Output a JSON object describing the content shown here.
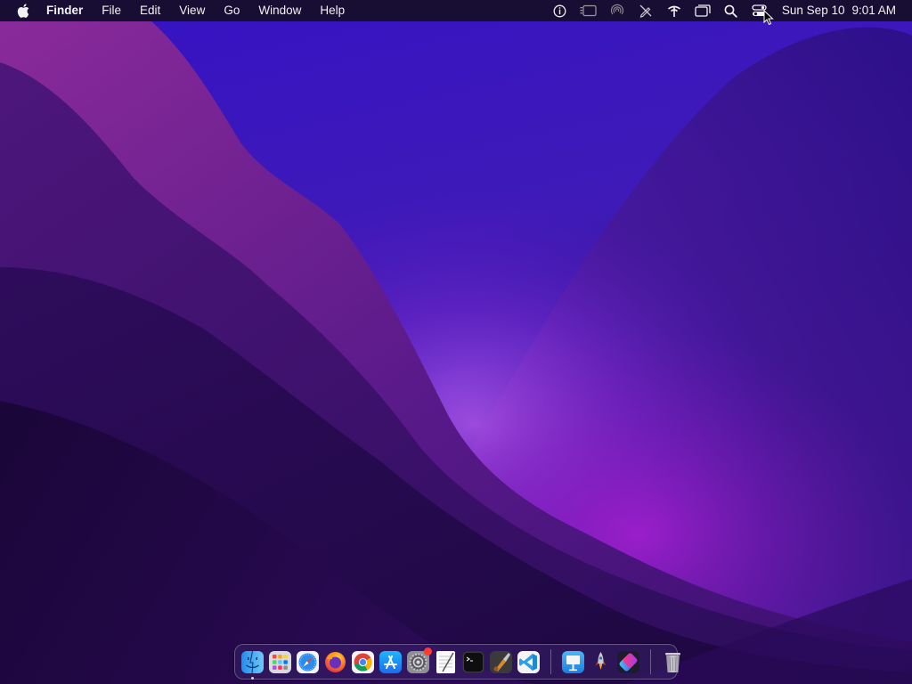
{
  "menubar": {
    "apple_icon": "apple-logo-icon",
    "app_name": "Finder",
    "menus": [
      "File",
      "Edit",
      "View",
      "Go",
      "Window",
      "Help"
    ],
    "status_icons": [
      "accessibility-icon",
      "screen-mirroring-icon",
      "airdrop-icon",
      "pen-slash-icon",
      "network-icon",
      "window-icon",
      "search-icon",
      "control-center-icon"
    ],
    "clock": {
      "date": "Sun Sep 10",
      "time": "9:01 AM"
    }
  },
  "dock": {
    "apps": [
      {
        "name": "finder-icon",
        "running": true
      },
      {
        "name": "launchpad-icon",
        "running": false
      },
      {
        "name": "safari-icon",
        "running": false
      },
      {
        "name": "firefox-icon",
        "running": false
      },
      {
        "name": "chrome-icon",
        "running": false
      },
      {
        "name": "app-store-icon",
        "running": false
      },
      {
        "name": "system-preferences-icon",
        "running": false,
        "badge": true
      },
      {
        "name": "textedit-icon",
        "running": false
      },
      {
        "name": "terminal-icon",
        "running": false
      },
      {
        "name": "instruments-icon",
        "running": false
      },
      {
        "name": "vscode-icon",
        "running": false
      }
    ],
    "others": [
      {
        "name": "keynote-icon"
      },
      {
        "name": "rocket-typist-icon"
      },
      {
        "name": "shortcuts-icon"
      }
    ],
    "trash": {
      "name": "trash-icon"
    }
  },
  "colors": {
    "wallpaper_top": "#3a16c8",
    "wallpaper_glow": "#9b2be0",
    "wallpaper_dark": "#1a0a3c",
    "menubar": "#160e28"
  }
}
